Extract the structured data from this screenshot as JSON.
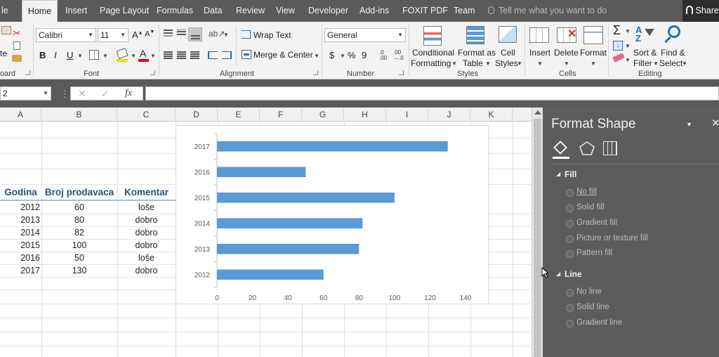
{
  "tabs": {
    "file_partial": "le",
    "home": "Home",
    "insert": "Insert",
    "page_layout": "Page Layout",
    "formulas": "Formulas",
    "data": "Data",
    "review": "Review",
    "view": "View",
    "developer": "Developer",
    "addins": "Add-ins",
    "foxit": "FOXIT PDF",
    "team": "Team"
  },
  "tell_me": "Tell me what you want to do",
  "share": "Share",
  "ribbon": {
    "clipboard_label": "oard",
    "paste_partial": "te",
    "font": {
      "name": "Calibri",
      "size": "11",
      "label": "Font",
      "bold": "B",
      "italic": "I",
      "underline": "U"
    },
    "alignment": {
      "wrap_text": "Wrap Text",
      "merge_center": "Merge & Center",
      "label": "Alignment"
    },
    "number": {
      "format": "General",
      "label": "Number",
      "currency": "$",
      "percent": "%",
      "comma": "9"
    },
    "styles": {
      "conditional_1": "Conditional",
      "conditional_2": "Formatting",
      "format_as_1": "Format as",
      "format_as_2": "Table",
      "cell_1": "Cell",
      "cell_2": "Styles",
      "label": "Styles"
    },
    "cells": {
      "insert": "Insert",
      "delete": "Delete",
      "format": "Format",
      "label": "Cells"
    },
    "editing": {
      "sort_1": "Sort &",
      "sort_2": "Filter",
      "find_1": "Find &",
      "find_2": "Select",
      "label": "Editing"
    }
  },
  "formula_bar": {
    "name_box": "2",
    "fx": "fx",
    "value": ""
  },
  "columns": [
    "A",
    "B",
    "C",
    "D",
    "E",
    "F",
    "G",
    "H",
    "I",
    "J",
    "K"
  ],
  "table": {
    "headers": [
      "Godina",
      "Broj prodavaca",
      "Komentar"
    ],
    "rows": [
      [
        "2012",
        "60",
        "loše"
      ],
      [
        "2013",
        "80",
        "dobro"
      ],
      [
        "2014",
        "82",
        "dobro"
      ],
      [
        "2015",
        "100",
        "dobro"
      ],
      [
        "2016",
        "50",
        "loše"
      ],
      [
        "2017",
        "130",
        "dobro"
      ]
    ]
  },
  "chart_data": {
    "type": "bar",
    "orientation": "horizontal",
    "categories": [
      "2012",
      "2013",
      "2014",
      "2015",
      "2016",
      "2017"
    ],
    "values": [
      60,
      80,
      82,
      100,
      50,
      130
    ],
    "xlim": [
      0,
      140
    ],
    "xticks": [
      "0",
      "20",
      "40",
      "60",
      "80",
      "100",
      "120",
      "140"
    ],
    "bar_color": "#5b9bd5",
    "grid": false,
    "title": "",
    "xlabel": "",
    "ylabel": ""
  },
  "format_panel": {
    "title": "Format Shape",
    "fill_section": "Fill",
    "fill_options": [
      "No fill",
      "Solid fill",
      "Gradient fill",
      "Picture or texture fill",
      "Pattern fill"
    ],
    "line_section": "Line",
    "line_options": [
      "No line",
      "Solid line",
      "Gradient line"
    ]
  },
  "colors": {
    "accent": "#217346",
    "header_text": "#2e4f78",
    "panel_bg": "#5c5c5c"
  }
}
